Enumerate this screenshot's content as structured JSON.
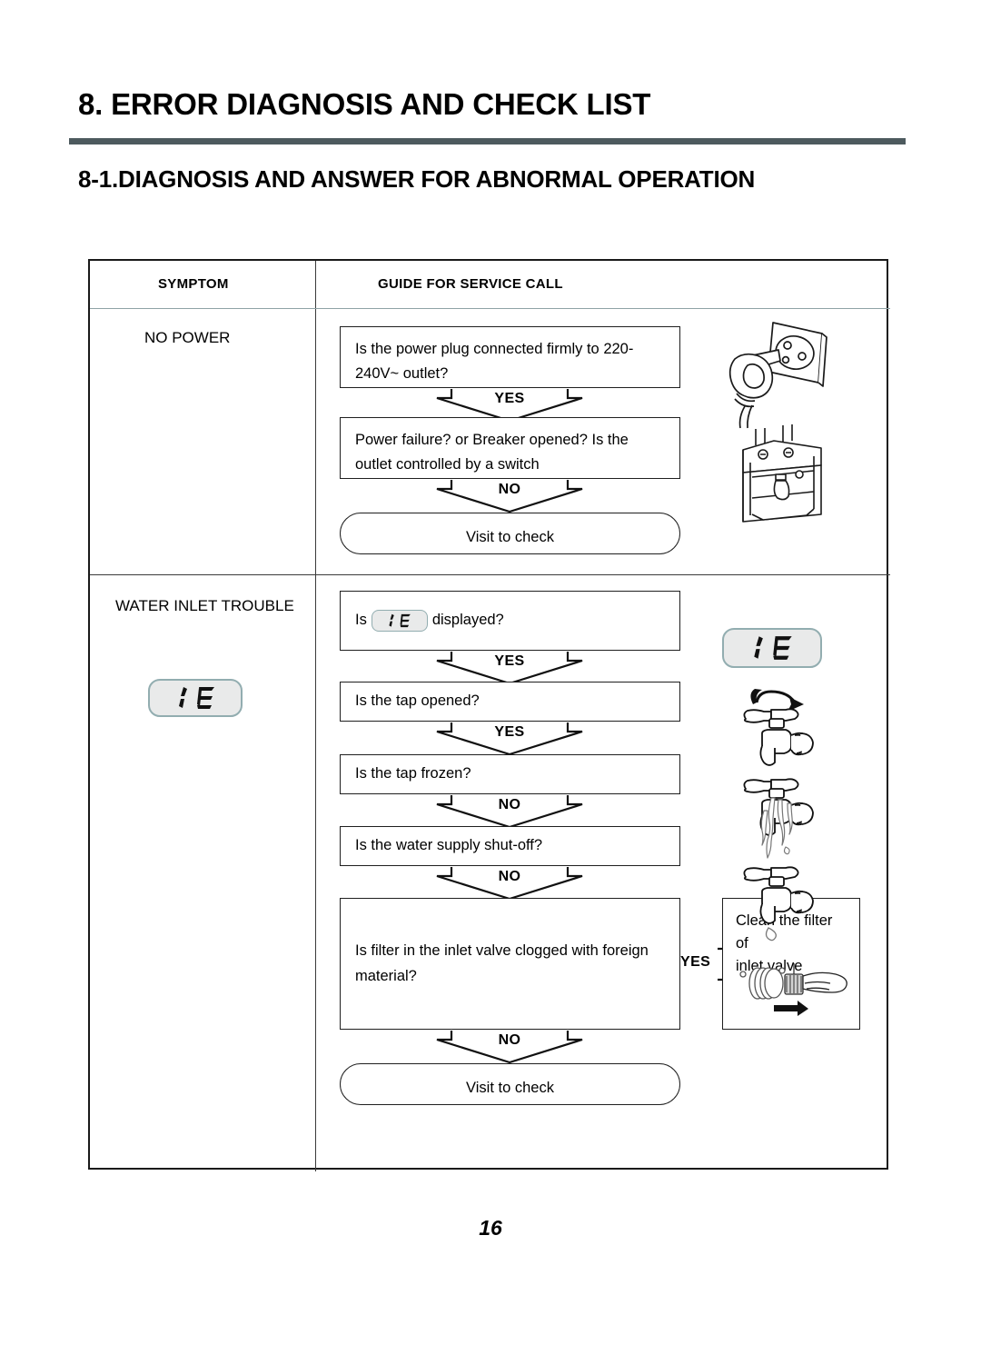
{
  "document": {
    "chapter_title": "8. ERROR DIAGNOSIS AND CHECK LIST",
    "section_title": "8-1.DIAGNOSIS AND ANSWER FOR ABNORMAL OPERATION",
    "page_number": "16",
    "rule_color": "#4d5a5e"
  },
  "table": {
    "headers": {
      "symptom": "SYMPTOM",
      "guide": "GUIDE FOR SERVICE CALL"
    },
    "rows": [
      {
        "symptom": "NO POWER",
        "steps": [
          {
            "line1": "Is the power plug connected firmly to",
            "line2": "220-240V~ outlet?"
          },
          {
            "line1": "Power failure? or Breaker opened?",
            "line2": "Is the outlet controlled by a switch"
          }
        ],
        "connectors": [
          "YES",
          "NO"
        ],
        "terminal": "Visit to check",
        "illustrations": [
          "power-plug-outlet-illustration",
          "circuit-breaker-illustration"
        ]
      },
      {
        "symptom": "WATER INLET TROUBLE",
        "error_code": {
          "digits": "IE",
          "fill_color": "#e9eaea",
          "border_color": "#92adb0"
        },
        "steps": [
          {
            "prefix": "Is",
            "badge": "IE",
            "suffix": "displayed?"
          },
          {
            "line1": "Is the tap opened?"
          },
          {
            "line1": "Is the tap frozen?"
          },
          {
            "line1": "Is the water supply shut-off?"
          },
          {
            "line1": "Is filter in the inlet valve clogged with foreign",
            "line2": "material?"
          }
        ],
        "connectors": [
          "YES",
          "YES",
          "NO",
          "NO",
          "NO"
        ],
        "branch": {
          "label": "YES",
          "box_line1": "Clean the filter of",
          "box_line2": "inlet valve",
          "illustration": "hand-removing-filter-illustration"
        },
        "terminal": "Visit to check",
        "illustrations": [
          "error-code-display-illustration",
          "tap-open-rotation-illustration",
          "tap-frozen-illustration",
          "tap-dripping-illustration"
        ]
      }
    ]
  }
}
